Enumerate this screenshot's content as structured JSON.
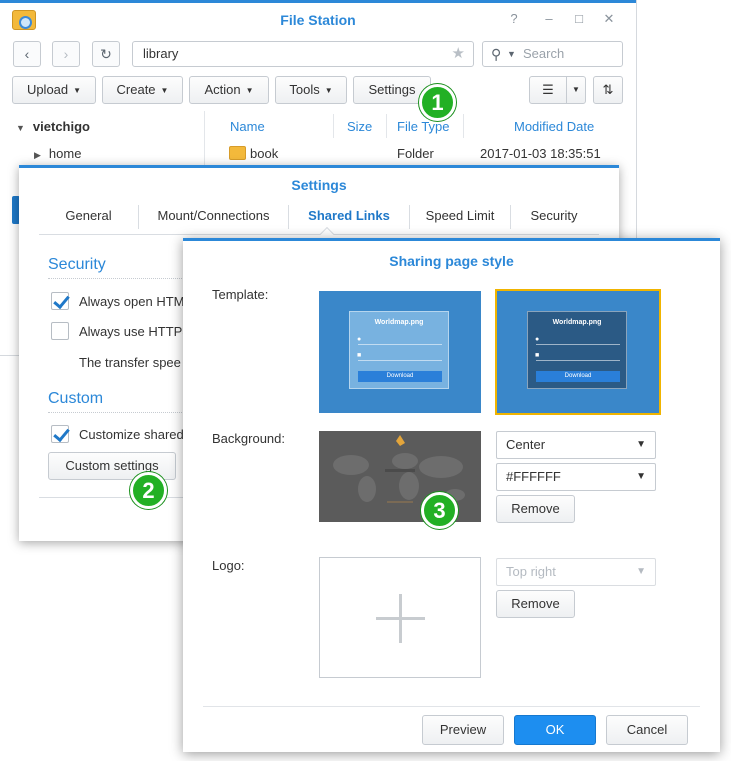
{
  "file_station": {
    "title": "File Station",
    "window_controls": [
      "?",
      "–",
      "□",
      "✕"
    ],
    "path": "library",
    "search_placeholder": "Search",
    "toolbar": {
      "upload": "Upload",
      "create": "Create",
      "action": "Action",
      "tools": "Tools",
      "settings": "Settings"
    },
    "tree": {
      "root": "vietchigo",
      "child": "home"
    },
    "columns": [
      "Name",
      "Size",
      "File Type",
      "Modified Date"
    ],
    "rows": [
      {
        "name": "book",
        "size": "",
        "type": "Folder",
        "modified": "2017-01-03 18:35:51"
      }
    ]
  },
  "settings": {
    "title": "Settings",
    "tabs": [
      "General",
      "Mount/Connections",
      "Shared Links",
      "Speed Limit",
      "Security"
    ],
    "active_tab": "Shared Links",
    "security_heading": "Security",
    "options": [
      {
        "label": "Always open HTM",
        "checked": true
      },
      {
        "label": "Always use HTTPS",
        "checked": false
      }
    ],
    "transfer_note": "The transfer spee",
    "custom_heading": "Custom",
    "custom_option": {
      "label": "Customize shared",
      "checked": true
    },
    "custom_button": "Custom settings"
  },
  "sharing_style": {
    "title": "Sharing page style",
    "template_label": "Template:",
    "templates": [
      {
        "file": "Worldmap.png",
        "button": "Download",
        "selected": false
      },
      {
        "file": "Worldmap.png",
        "button": "Download",
        "selected": true
      }
    ],
    "background_label": "Background:",
    "background_position": "Center",
    "background_color": "#FFFFFF",
    "remove_label": "Remove",
    "logo_label": "Logo:",
    "logo_position": "Top right",
    "buttons": {
      "preview": "Preview",
      "ok": "OK",
      "cancel": "Cancel"
    }
  },
  "steps": [
    "1",
    "2",
    "3"
  ],
  "colors": {
    "accent": "#2c88d8",
    "primary_button": "#1d8ef0",
    "step_marker": "#22b024",
    "selected_outline": "#f0b400"
  }
}
